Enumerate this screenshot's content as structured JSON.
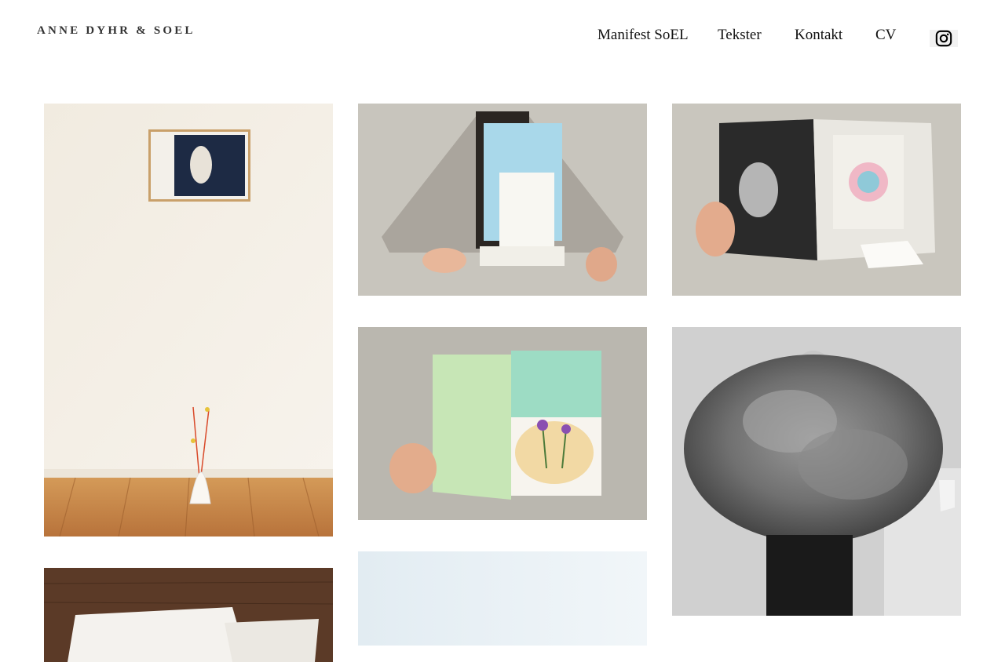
{
  "header": {
    "site_title": "ANNE DYHR & SOEL",
    "nav": [
      {
        "label": "Manifest SoEL"
      },
      {
        "label": "Tekster"
      },
      {
        "label": "Kontakt"
      },
      {
        "label": "CV"
      }
    ],
    "social_icon": "instagram-icon"
  },
  "gallery": {
    "items": [
      {
        "name": "framed-photo-with-vase",
        "colors": {
          "wall": "#f4efe6",
          "floor": "#c98a4a"
        }
      },
      {
        "name": "folder-with-booklet",
        "colors": {
          "background": "#c9c6be",
          "paper": "#a9a39c"
        }
      },
      {
        "name": "open-book-with-photo",
        "colors": {
          "background": "#c9c6be"
        }
      },
      {
        "name": "green-book-thistle",
        "colors": {
          "background": "#b9b6ae",
          "cover": "#bfe0b0"
        }
      },
      {
        "name": "woman-with-wool",
        "colors": {
          "background": "#cfcfcf"
        }
      },
      {
        "name": "paper-on-wooden-table",
        "colors": {
          "background": "#5a3a28"
        }
      },
      {
        "name": "pale-sky-photo",
        "colors": {
          "background": "#e8f0f5"
        }
      }
    ]
  }
}
